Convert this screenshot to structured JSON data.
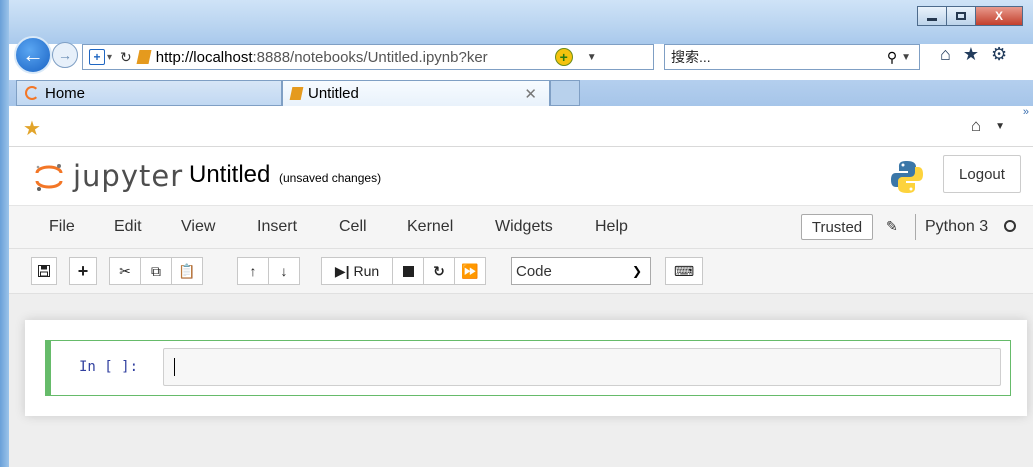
{
  "browser": {
    "url_host": "http://localhost",
    "url_rest": ":8888/notebooks/Untitled.ipynb?ker",
    "search_placeholder": "搜索...",
    "tabs": [
      {
        "label": "Home"
      },
      {
        "label": "Untitled",
        "active": true
      }
    ],
    "window_close_glyph": "X"
  },
  "jupyter": {
    "logo_text": "jupyter",
    "notebook_name": "Untitled",
    "save_status": "(unsaved changes)",
    "logout_label": "Logout",
    "menu": [
      "File",
      "Edit",
      "View",
      "Insert",
      "Cell",
      "Kernel",
      "Widgets",
      "Help"
    ],
    "trusted_label": "Trusted",
    "kernel_name": "Python 3",
    "toolbar": {
      "run_label": "Run",
      "cell_type": "Code"
    },
    "cell": {
      "prompt": "In [ ]:"
    }
  },
  "colors": {
    "jupyter_orange": "#f37626",
    "cell_border": "#66bb6a",
    "prompt_blue": "#303f9f"
  }
}
